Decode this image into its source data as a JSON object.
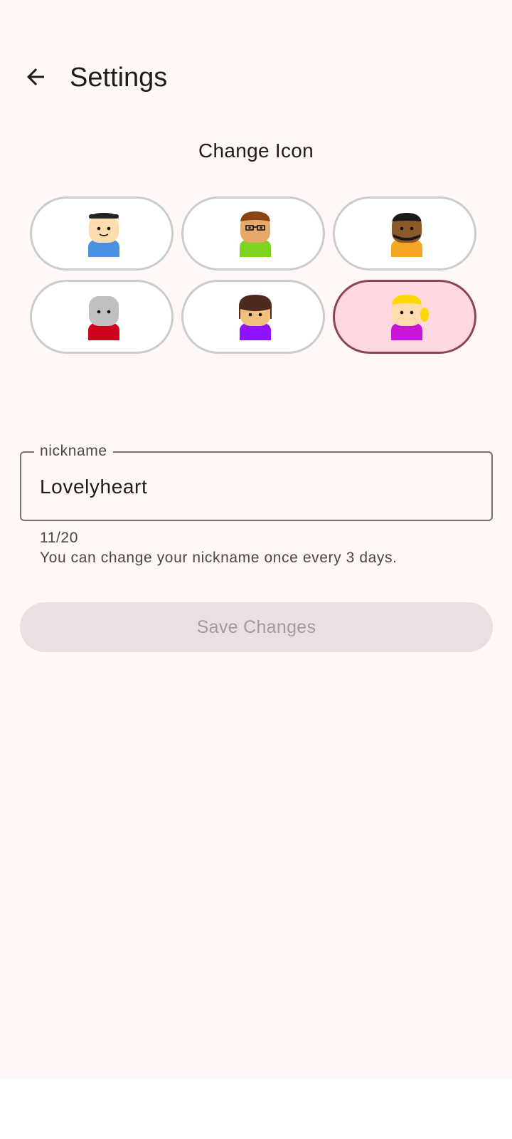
{
  "header": {
    "title": "Settings",
    "back_icon": "arrow-back-icon"
  },
  "icon_section": {
    "title": "Change Icon",
    "options": [
      {
        "name": "avatar-boy-blue-shirt",
        "selected": false,
        "skin": "#ffdcae",
        "hair": "#222222",
        "shirt": "#4a90e2"
      },
      {
        "name": "avatar-glasses-green-shirt",
        "selected": false,
        "skin": "#e5a96a",
        "hair": "#8b4513",
        "shirt": "#7ed321"
      },
      {
        "name": "avatar-beard-orange-shirt",
        "selected": false,
        "skin": "#8b5a2b",
        "hair": "#1a1a1a",
        "shirt": "#f5a623"
      },
      {
        "name": "avatar-grey-red-shirt",
        "selected": false,
        "skin": "#c0c0c0",
        "hair": "#c0c0c0",
        "shirt": "#d0021b"
      },
      {
        "name": "avatar-brown-hair-purple-shirt",
        "selected": false,
        "skin": "#f0c27b",
        "hair": "#4e2a1e",
        "shirt": "#9013fe"
      },
      {
        "name": "avatar-blonde-magenta-shirt",
        "selected": true,
        "skin": "#ffdcae",
        "hair": "#ffd700",
        "shirt": "#c815d6"
      }
    ]
  },
  "nickname_field": {
    "label": "nickname",
    "value": "Lovelyheart",
    "counter": "11/20",
    "hint": "You can change your nickname once every 3 days."
  },
  "save_button": {
    "label": "Save Changes",
    "enabled": false
  },
  "colors": {
    "background": "#fff8f7",
    "selected_border": "#8e4456",
    "selected_fill": "#ffd9df",
    "unselected_border": "#cccccc",
    "button_disabled_bg": "#ebe0e1",
    "button_disabled_text": "#a59b9d"
  }
}
